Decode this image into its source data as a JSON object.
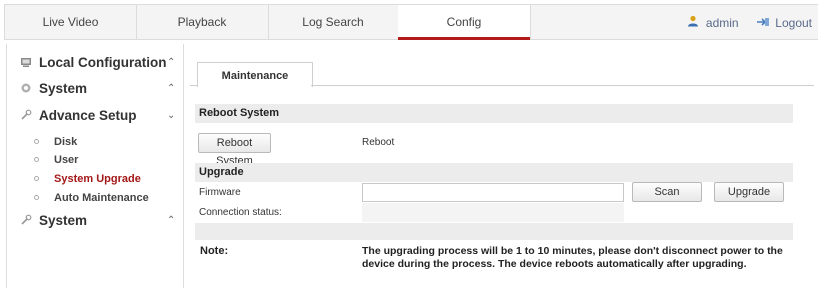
{
  "topnav": {
    "tabs": [
      {
        "label": "Live Video"
      },
      {
        "label": "Playback"
      },
      {
        "label": "Log Search"
      },
      {
        "label": "Config",
        "active": true
      }
    ],
    "user": {
      "name": "admin",
      "logout_label": "Logout"
    },
    "accent_color": "#b31b1b"
  },
  "sidebar": {
    "groups": [
      {
        "label": "Local Configuration",
        "icon": "local-config-icon",
        "chevron": "^"
      },
      {
        "label": "System",
        "icon": "system-icon",
        "chevron": "^"
      },
      {
        "label": "Advance Setup",
        "icon": "wrench-icon",
        "chevron": "v"
      },
      {
        "label": "System",
        "icon": "wrench-icon",
        "chevron": "^"
      }
    ],
    "items": [
      {
        "label": "Disk"
      },
      {
        "label": "User"
      },
      {
        "label": "System Upgrade",
        "active": true
      },
      {
        "label": "Auto Maintenance"
      }
    ]
  },
  "content": {
    "tab_label": "Maintenance",
    "reboot": {
      "section_title": "Reboot System",
      "button_label": "Reboot System",
      "description": "Reboot"
    },
    "upgrade": {
      "section_title": "Upgrade",
      "firmware_label": "Firmware",
      "firmware_value": "",
      "scan_label": "Scan",
      "upgrade_label": "Upgrade",
      "status_label": "Connection status:"
    },
    "note": {
      "label": "Note:",
      "text": "The upgrading process will be 1 to 10 minutes, please don't disconnect power to the device during the process. The device reboots automatically after upgrading."
    }
  }
}
